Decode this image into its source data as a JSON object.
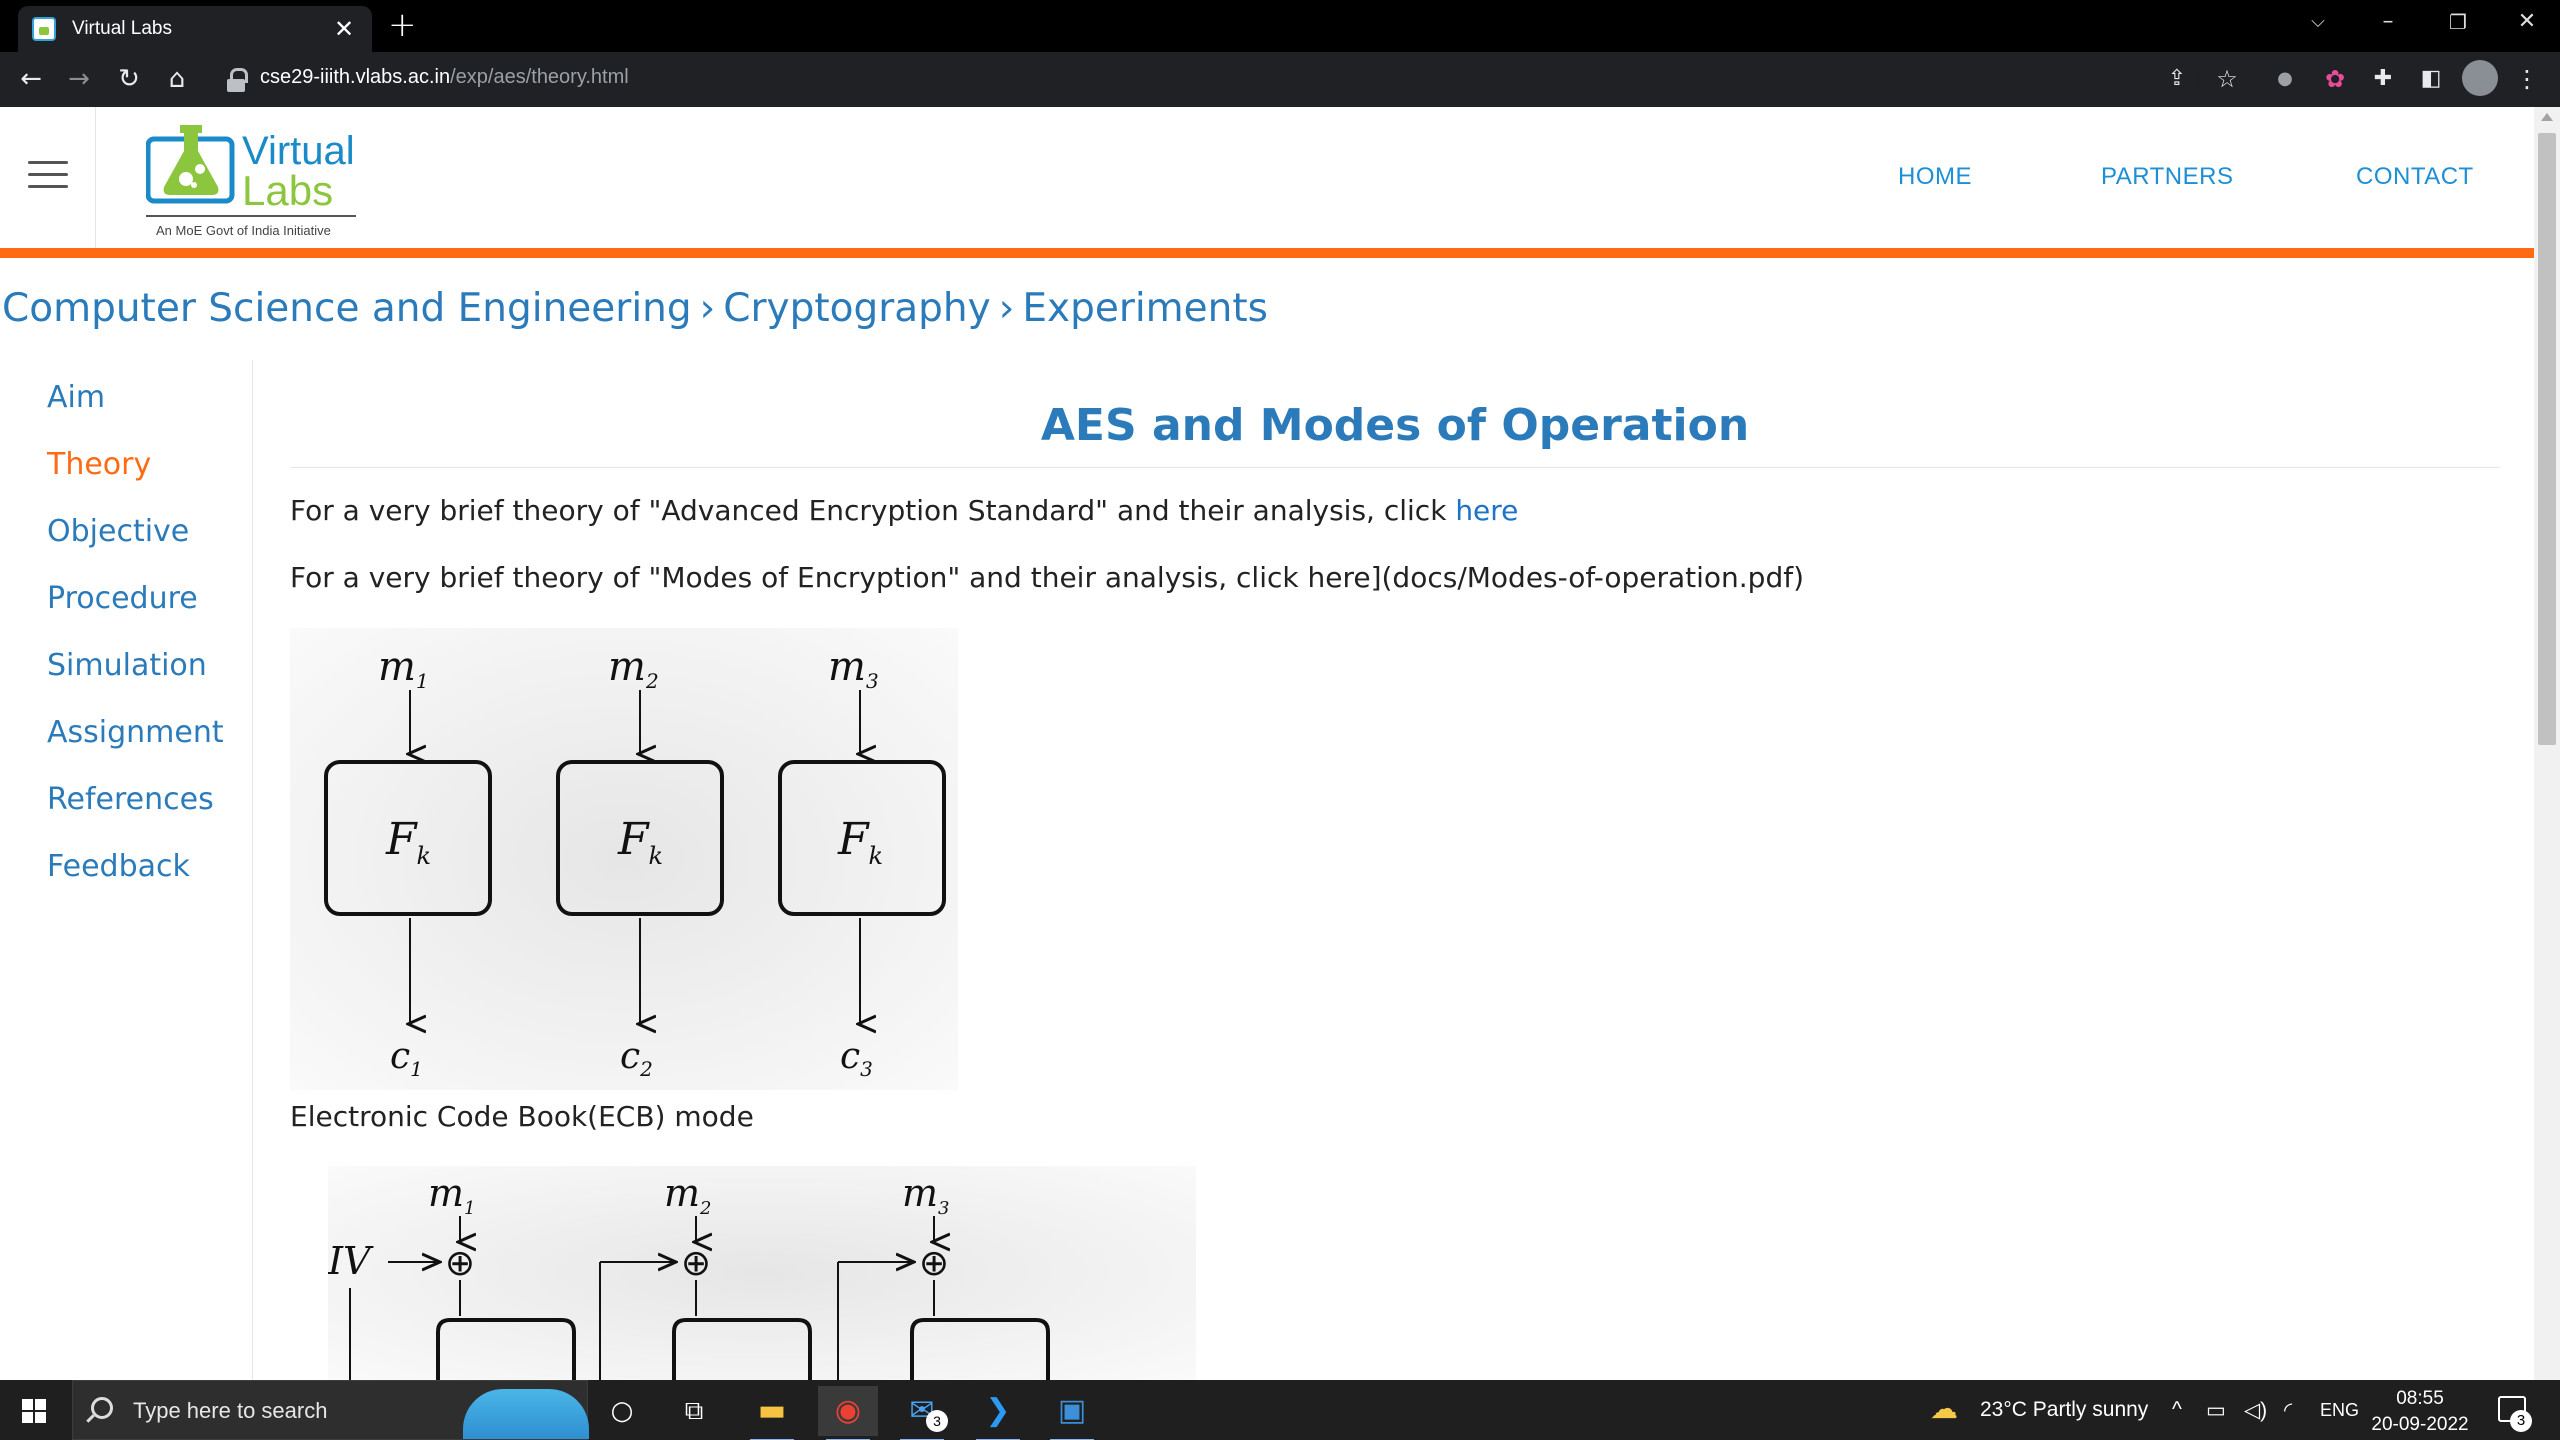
{
  "browser": {
    "tab_title": "Virtual Labs",
    "tab_close": "✕",
    "new_tab": "+",
    "url_domain": "cse29-iiith.vlabs.ac.in",
    "url_path": "/exp/aes/theory.html"
  },
  "header": {
    "brand_line1": "Virtual",
    "brand_line2": "Labs",
    "tagline": "An MoE Govt of India Initiative",
    "nav": [
      "HOME",
      "PARTNERS",
      "CONTACT"
    ]
  },
  "breadcrumb": [
    "Computer Science and Engineering",
    "Cryptography",
    "Experiments"
  ],
  "breadcrumb_separator": "›",
  "sidebar": {
    "items": [
      "Aim",
      "Theory",
      "Objective",
      "Procedure",
      "Simulation",
      "Assignment",
      "References",
      "Feedback"
    ],
    "active": "Theory"
  },
  "content": {
    "title": "AES and Modes of Operation",
    "para1_text": "For a very brief theory of \"Advanced Encryption Standard\" and their analysis, click ",
    "para1_link": "here",
    "para2_text": "For a very brief theory of \"Modes of Encryption\" and their analysis, click here](docs/Modes-of-operation.pdf)",
    "ecb_caption": "Electronic Code Book(ECB) mode",
    "ecb_figure": {
      "inputs": [
        "m",
        "m",
        "m"
      ],
      "input_subscripts": [
        "1",
        "2",
        "3"
      ],
      "block_label": "F",
      "block_subscript": "k",
      "outputs": [
        "c",
        "c",
        "c"
      ],
      "output_subscripts": [
        "1",
        "2",
        "3"
      ]
    },
    "cbc_figure": {
      "iv_label": "IV",
      "inputs": [
        "m",
        "m",
        "m"
      ],
      "input_subscripts": [
        "1",
        "2",
        "3"
      ],
      "xor_symbol": "⊕"
    }
  },
  "taskbar": {
    "search_placeholder": "Type here to search",
    "weather": "23°C  Partly sunny",
    "language": "ENG",
    "time": "08:55",
    "date": "20-09-2022",
    "mail_badge": "3",
    "notification_count": "3"
  }
}
